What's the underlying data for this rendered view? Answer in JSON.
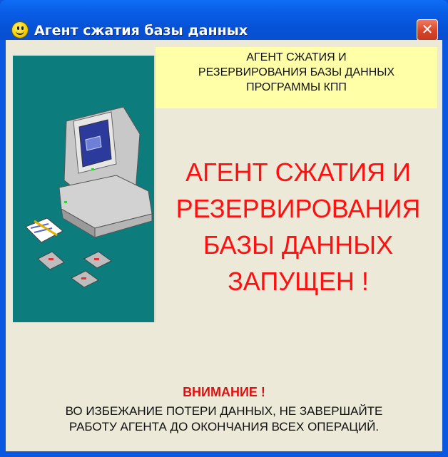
{
  "window": {
    "title": "Агент сжатия базы данных",
    "close_glyph": "✕"
  },
  "header_box": {
    "lines": [
      "АГЕНТ СЖАТИЯ И",
      "РЕЗЕРВИРОВАНИЯ  БАЗЫ ДАННЫХ",
      "ПРОГРАММЫ КПП"
    ]
  },
  "status": {
    "lines": [
      "АГЕНТ СЖАТИЯ И",
      "РЕЗЕРВИРОВАНИЯ",
      "БАЗЫ ДАННЫХ",
      "ЗАПУЩЕН !"
    ]
  },
  "notice": {
    "heading": "ВНИМАНИЕ !",
    "lines": [
      "ВО ИЗБЕЖАНИЕ ПОТЕРИ ДАННЫХ,  НЕ ЗАВЕРШАЙТЕ",
      "РАБОТУ АГЕНТА ДО ОКОНЧАНИЯ ВСЕХ ОПЕРАЦИЙ."
    ]
  },
  "icons": {
    "title_icon": "smiley-icon",
    "illustration": "computer-illustration"
  },
  "colors": {
    "titlebar": "#0a5de6",
    "client_bg": "#ece9d8",
    "panel_teal": "#0c7d7c",
    "header_box_bg": "#ffffa8",
    "status_text": "#ff1010",
    "notice_heading": "#e01010",
    "close_button": "#d8452a"
  }
}
